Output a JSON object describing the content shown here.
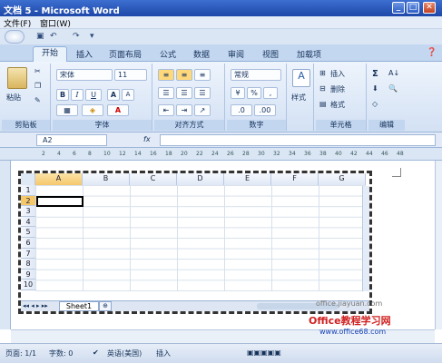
{
  "window": {
    "title": "文档 5 - Microsoft Word"
  },
  "menu": {
    "file": "文件(F)",
    "window": "窗口(W)"
  },
  "tabs": [
    "开始",
    "插入",
    "页面布局",
    "公式",
    "数据",
    "审阅",
    "视图",
    "加载项"
  ],
  "ribbon": {
    "clipboard": {
      "label": "剪贴板",
      "paste": "粘贴"
    },
    "font": {
      "label": "字体",
      "name": "宋体",
      "size": "11",
      "bold": "B",
      "italic": "I",
      "underline": "U",
      "grow": "A",
      "shrink": "A"
    },
    "alignment": {
      "label": "对齐方式"
    },
    "number": {
      "label": "数字",
      "format": "常规",
      "percent": "%",
      "comma": ","
    },
    "styles": {
      "label": "样式"
    },
    "cells": {
      "label": "单元格",
      "insert": "插入",
      "delete": "删除",
      "format": "格式"
    },
    "editing": {
      "label": "编辑",
      "sum": "Σ"
    }
  },
  "formula_bar": {
    "name_box": "A2",
    "fx": "fx"
  },
  "ruler": [
    "2",
    "4",
    "6",
    "8",
    "10",
    "12",
    "14",
    "16",
    "18",
    "20",
    "22",
    "24",
    "26",
    "28",
    "30",
    "32",
    "34",
    "36",
    "38",
    "40",
    "42",
    "44",
    "46",
    "48"
  ],
  "sheet": {
    "columns": [
      "A",
      "B",
      "C",
      "D",
      "E",
      "F",
      "G"
    ],
    "rows": [
      "1",
      "2",
      "3",
      "4",
      "5",
      "6",
      "7",
      "8",
      "9",
      "10"
    ],
    "tab": "Sheet1"
  },
  "status": {
    "page": "页面: 1/1",
    "words": "字数: 0",
    "language": "英语(美国)",
    "mode": "插入"
  },
  "watermark": {
    "site": "office.jiayuan.com",
    "brand": "Office教程学习网",
    "url": "www.office68.com"
  }
}
